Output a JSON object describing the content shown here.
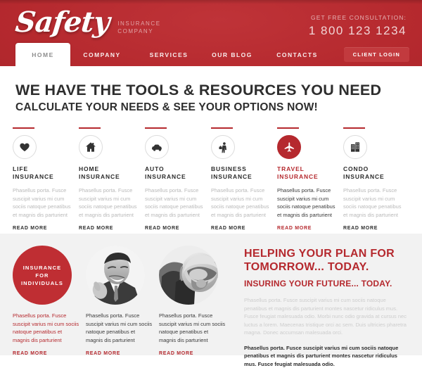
{
  "header": {
    "logo_name": "Safety",
    "logo_sub_line1": "INSURANCE",
    "logo_sub_line2": "COMPANY",
    "consult_label": "GET FREE CONSULTATION:",
    "consult_phone": "1 800 123 1234",
    "login_label": "CLIENT LOGIN",
    "brand_red": "#b5292e",
    "nav": [
      {
        "label": "HOME",
        "active": true
      },
      {
        "label": "COMPANY",
        "active": false
      },
      {
        "label": "SERVICES",
        "active": false
      },
      {
        "label": "OUR BLOG",
        "active": false
      },
      {
        "label": "CONTACTS",
        "active": false
      }
    ]
  },
  "hero": {
    "headline": "WE HAVE THE TOOLS & RESOURCES YOU NEED",
    "subheadline": "CALCULATE YOUR NEEDS & SEE YOUR OPTIONS NOW!"
  },
  "services": {
    "body_text": "Phasellus porta. Fusce suscipit varius mi cum sociis natoque penatibus et magnis dis parturient",
    "read_more": "READ MORE",
    "items": [
      {
        "title": "LIFE\nINSURANCE",
        "icon": "heart-icon",
        "active": false
      },
      {
        "title": "HOME\nINSURANCE",
        "icon": "house-icon",
        "active": false
      },
      {
        "title": "AUTO\nINSURANCE",
        "icon": "car-icon",
        "active": false
      },
      {
        "title": "BUSINESS\nINSURANCE",
        "icon": "businessperson-icon",
        "active": false
      },
      {
        "title": "TRAVEL\nINSURANCE",
        "icon": "airplane-icon",
        "active": true
      },
      {
        "title": "CONDO\nINSURANCE",
        "icon": "building-icon",
        "active": false
      }
    ]
  },
  "individuals": {
    "badge_line1": "INSURANCE",
    "badge_line2": "FOR",
    "badge_line3": "INDIVIDUALS",
    "body_text": "Phasellus porta. Fusce suscipit varius mi cum sociis natoque penatibus et magnis dis parturient",
    "read_more": "READ MORE",
    "photos": [
      {
        "name": "smiling-businessman-photo"
      },
      {
        "name": "helmet-racer-photo"
      }
    ]
  },
  "promo": {
    "title": "HELPING YOUR PLAN FOR TOMORROW... TODAY.",
    "subtitle": "INSURING YOUR FUTURE... TODAY.",
    "paragraph_light": "Phasellus porta. Fusce suscipit varius mi cum sociis natoque penatibus et magnis dis parturient montes nascetur ridiculus mus. Fusce feugiat malesuada odio. Morbi nunc odio gravida at cursus nec luctus a lorem. Maecenas tristique orci ac sem. Duis ultricies pharetra magna. Donec accumsan malesuada orci.",
    "paragraph_bold": "Phasellus porta. Fusce suscipit varius mi cum sociis natoque penatibus et magnis dis parturient montes nascetur ridiculus mus. Fusce feugiat malesuada odio."
  }
}
